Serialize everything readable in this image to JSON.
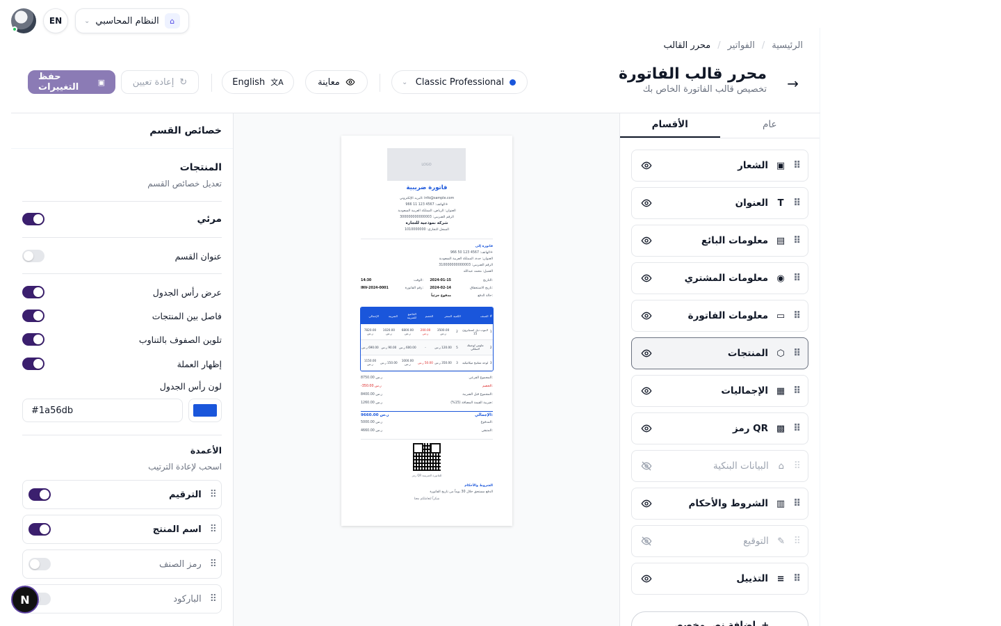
{
  "topbar": {
    "lang_button": "EN",
    "system_select": "النظام المحاسبي"
  },
  "breadcrumb": {
    "items": [
      "الرئيسية",
      "الفواتير",
      "محرر القالب"
    ]
  },
  "header": {
    "title": "محرر قالب الفاتورة",
    "subtitle": "تخصيص قالب الفاتورة الخاص بك",
    "template_select": "Classic Professional",
    "preview_label": "معاينة",
    "language_label": "English",
    "reset_label": "إعادة تعيين",
    "save_label": "حفظ التغييرات"
  },
  "properties": {
    "panel_title": "خصائص القسم",
    "section_name": "المنتجات",
    "section_desc": "تعديل خصائص القسم",
    "toggles": [
      {
        "label": "مرئي",
        "on": true
      },
      {
        "label": "عنوان القسم",
        "on": false
      },
      {
        "label": "عرض رأس الجدول",
        "on": true
      },
      {
        "label": "فاصل بين المنتجات",
        "on": true
      },
      {
        "label": "تلوين الصفوف بالتناوب",
        "on": true
      },
      {
        "label": "إظهار العملة",
        "on": true
      }
    ],
    "header_color_label": "لون رأس الجدول",
    "header_color_value": "#1a56db",
    "columns_title": "الأعمدة",
    "columns_hint": "اسحب لإعادة الترتيب",
    "columns": [
      {
        "label": "الترقيم",
        "on": true
      },
      {
        "label": "اسم المنتج",
        "on": true
      },
      {
        "label": "رمز الصنف",
        "on": false
      },
      {
        "label": "الباركود",
        "on": false
      }
    ]
  },
  "preview": {
    "logo_text": "LOGO",
    "invoice_title": "فاتورة ضريبية",
    "seller_lines": [
      "البريد الإلكتروني: info@sample.com",
      "الهاتف: 4567 123 11 966+",
      "العنوان: الرياض، المملكة العربية السعودية",
      "الرقم الضريبي: 300000000000003"
    ],
    "seller_name": "شركة نموذجية للتجارة",
    "seller_cr": "السجل التجاري: 1010000000",
    "buyer_label": "فاتورة إلى",
    "buyer_lines": [
      "الهاتف: 4567 123 50 966+",
      "العنوان: جدة، المملكة العربية السعودية",
      "الرقم الضريبي: 310000000000003",
      "العميل: محمد عبدالله"
    ],
    "meta": {
      "date_label": "التاريخ:",
      "date": "2024-01-15",
      "time_label": "الوقت:",
      "time": "14:30",
      "due_label": "تاريخ الاستحقاق:",
      "due": "2024-02-14",
      "number_label": "رقم الفاتورة:",
      "number": "INV-2024-0001",
      "status_label": "حالة الدفع:",
      "status": "مدفوع جزئياً"
    },
    "table_headers": [
      "#",
      "الصنف",
      "الكمية",
      "السعر",
      "الخصم",
      "الخاضع للضريبة",
      "الضريبة",
      "الإجمالي"
    ],
    "table_rows": [
      [
        "1",
        "لابتوب ديل انسبايرون 15",
        "2",
        "3500.00 ر.س",
        "200.00 ر.س",
        "6800.00 ر.س",
        "1020.00 ر.س",
        "7820.00 ر.س"
      ],
      [
        "2",
        "ماوس لوجيتك لاسلكي",
        "5",
        "120.00 ر.س",
        "-",
        "600.00 ر.س",
        "90.00 ر.س",
        "690.00 ر.س"
      ],
      [
        "3",
        "لوحة مفاتيح ميكانيكية",
        "3",
        "350.00 ر.س",
        "50.00 ر.س",
        "1000.00 ر.س",
        "150.00 ر.س",
        "1150.00 ر.س"
      ]
    ],
    "totals": [
      {
        "label": "المجموع الفرعي:",
        "value": "8750.00 ر.س",
        "style": ""
      },
      {
        "label": "الخصم:",
        "value": "-350.00 ر.س",
        "style": "red"
      },
      {
        "label": "المجموع قبل الضريبة:",
        "value": "8400.00 ر.س",
        "style": ""
      },
      {
        "label": "ضريبة القيمة المضافة (15%):",
        "value": "1260.00 ر.س",
        "style": ""
      },
      {
        "label": "الإجمالي:",
        "value": "9660.00 ر.س",
        "style": "grand"
      },
      {
        "label": "المدفوع:",
        "value": "5000.00 ر.س",
        "style": ""
      },
      {
        "label": "المتبقي:",
        "value": "4660.00 ر.س",
        "style": ""
      }
    ],
    "qr_caption": "رمز QR للفاتورة الضريبية",
    "terms_title": "الشروط والأحكام",
    "terms_text": "الدفع مستحق خلال 30 يوماً من تاريخ الفاتورة",
    "thanks": "شكراً لتعاملكم معنا"
  },
  "sections_panel": {
    "tabs": [
      "عام",
      "الأقسام"
    ],
    "active_tab": "الأقسام",
    "items": [
      {
        "label": "الشعار",
        "icon": "image-icon",
        "glyph": "▣",
        "visible": true
      },
      {
        "label": "العنوان",
        "icon": "text-icon",
        "glyph": "T",
        "visible": true
      },
      {
        "label": "معلومات البائع",
        "icon": "building-icon",
        "glyph": "▤",
        "visible": true
      },
      {
        "label": "معلومات المشتري",
        "icon": "user-circle-icon",
        "glyph": "◉",
        "visible": true
      },
      {
        "label": "معلومات الفاتورة",
        "icon": "file-text-icon",
        "glyph": "▭",
        "visible": true
      },
      {
        "label": "المنتجات",
        "icon": "package-icon",
        "glyph": "⬡",
        "visible": true,
        "active": true
      },
      {
        "label": "الإجماليات",
        "icon": "calculator-icon",
        "glyph": "▦",
        "visible": true
      },
      {
        "label": "رمز QR",
        "icon": "qr-code-icon",
        "glyph": "▩",
        "visible": true
      },
      {
        "label": "البيانات البنكية",
        "icon": "bank-icon",
        "glyph": "⌂",
        "visible": false
      },
      {
        "label": "الشروط والأحكام",
        "icon": "scroll-icon",
        "glyph": "▥",
        "visible": true
      },
      {
        "label": "التوقيع",
        "icon": "signature-icon",
        "glyph": "✎",
        "visible": false
      },
      {
        "label": "التذييل",
        "icon": "align-icon",
        "glyph": "≡",
        "visible": true
      }
    ],
    "add_button": "إضافة نص مخصص"
  },
  "floating_badge": "N",
  "colors": {
    "accent": "#1a56db",
    "toggle_on": "#3b1f6e",
    "save_button": "#8b7bb5"
  }
}
